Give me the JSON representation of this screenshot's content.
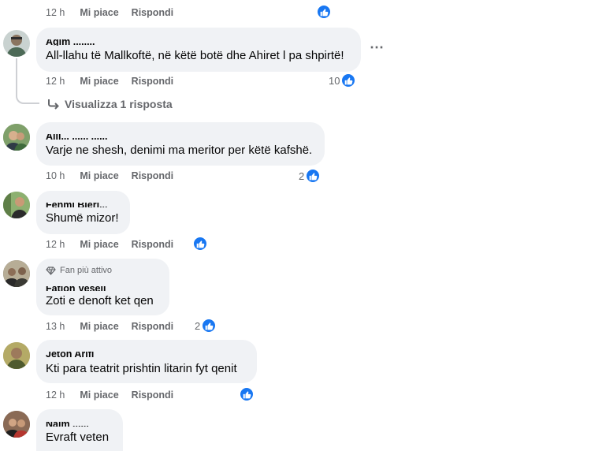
{
  "colors": {
    "bubble": "#f0f2f5",
    "like_blue": "#1877f2",
    "meta_gray": "#65676b"
  },
  "actions": {
    "like": "Mi piace",
    "reply": "Rispondi"
  },
  "top_row": {
    "time": "12 h"
  },
  "comments": [
    {
      "author": "Agim ........",
      "text": "All-llahu të Mallkoftë, në këtë botë dhe Ahiret l pa shpirtë!",
      "time": "12 h",
      "reactions": "10",
      "more_icon": "⋯",
      "view_replies": "Visualizza 1 risposta"
    },
    {
      "author": "Alll... ...... ......",
      "text": "Varje ne shesh, denimi ma meritor per këtë kafshë.",
      "time": "10 h",
      "reactions": "2"
    },
    {
      "author": "Fehmi Bleri...",
      "text": "Shumë mizor!",
      "time": "12 h",
      "reactions": ""
    },
    {
      "author": "Fatjon Veseli",
      "badge": "Fan più attivo",
      "text": "Zoti e denoft ket qen",
      "time": "13 h",
      "reactions": "2"
    },
    {
      "author": "Jeton Arifi",
      "text": "Kti para teatrit prishtin litarin fyt qenit",
      "time": "12 h",
      "reactions": ""
    },
    {
      "author": "Naim ......",
      "text": "Evraft veten"
    }
  ]
}
